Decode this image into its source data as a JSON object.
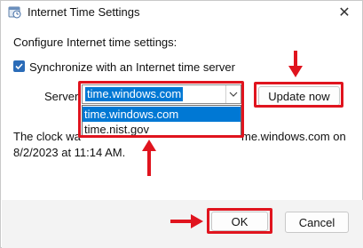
{
  "window": {
    "title": "Internet Time Settings",
    "close_glyph": "✕"
  },
  "main": {
    "header": "Configure Internet time settings:",
    "sync_label": "Synchronize with an Internet time server",
    "sync_checked": true,
    "server_label": "Server:",
    "server_value": "time.windows.com",
    "server_options": [
      "time.windows.com",
      "time.nist.gov"
    ],
    "selected_option_index": 0,
    "update_button": "Update now",
    "status_line1_prefix": "The clock wa",
    "status_line1_suffix": "me.windows.com on",
    "status_line2": "8/2/2023 at 11:14 AM."
  },
  "footer": {
    "ok_label": "OK",
    "cancel_label": "Cancel"
  },
  "icons": {
    "title": "clock-icon",
    "checkbox": "checkmark-icon",
    "dropdown": "chevron-down-icon",
    "close": "close-icon"
  },
  "colors": {
    "accent": "#0078d4",
    "checkbox": "#2b6cb8",
    "annotation": "#e0141e",
    "footer_bg": "#f3f3f3"
  }
}
